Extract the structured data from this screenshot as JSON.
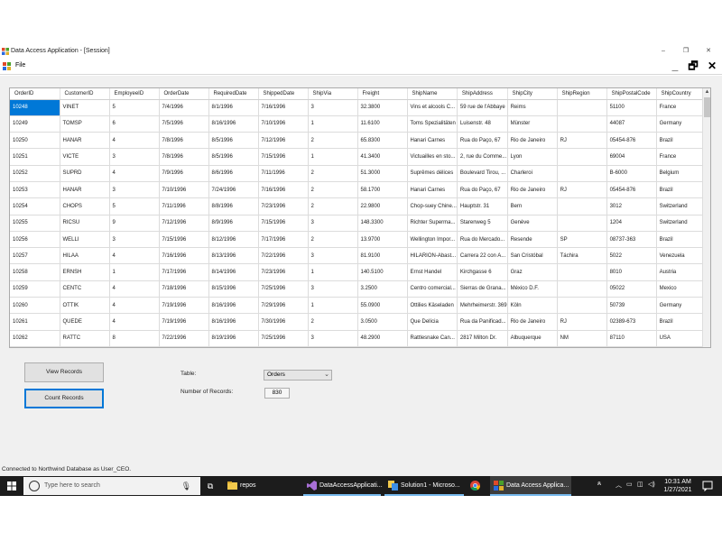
{
  "window": {
    "title": "Data Access Application - [Session]",
    "minimize": "–",
    "restore": "❐",
    "close": "✕"
  },
  "menu": {
    "file": "File",
    "mdi_minimize": "_",
    "mdi_restore": "🗗",
    "mdi_close": "✕"
  },
  "grid": {
    "columns": [
      "OrderID",
      "CustomerID",
      "EmployeeID",
      "OrderDate",
      "RequiredDate",
      "ShippedDate",
      "ShipVia",
      "Freight",
      "ShipName",
      "ShipAddress",
      "ShipCity",
      "ShipRegion",
      "ShipPostalCode",
      "ShipCountry"
    ],
    "rows": [
      [
        "10248",
        "VINET",
        "5",
        "7/4/1996",
        "8/1/1996",
        "7/16/1996",
        "3",
        "32.3800",
        "Vins et alcools C...",
        "59 rue de l'Abbaye",
        "Reims",
        "",
        "51100",
        "France"
      ],
      [
        "10249",
        "TOMSP",
        "6",
        "7/5/1996",
        "8/16/1996",
        "7/10/1996",
        "1",
        "11.6100",
        "Toms Spezialitäten",
        "Luisenstr. 48",
        "Münster",
        "",
        "44087",
        "Germany"
      ],
      [
        "10250",
        "HANAR",
        "4",
        "7/8/1996",
        "8/5/1996",
        "7/12/1996",
        "2",
        "65.8300",
        "Hanari Carnes",
        "Rua do Paço, 67",
        "Rio de Janeiro",
        "RJ",
        "05454-876",
        "Brazil"
      ],
      [
        "10251",
        "VICTE",
        "3",
        "7/8/1996",
        "8/5/1996",
        "7/15/1996",
        "1",
        "41.3400",
        "Victuailles en sto...",
        "2, rue du Comme...",
        "Lyon",
        "",
        "69004",
        "France"
      ],
      [
        "10252",
        "SUPRD",
        "4",
        "7/9/1996",
        "8/6/1996",
        "7/11/1996",
        "2",
        "51.3000",
        "Suprêmes délices",
        "Boulevard Tirou, ...",
        "Charleroi",
        "",
        "B-6000",
        "Belgium"
      ],
      [
        "10253",
        "HANAR",
        "3",
        "7/10/1996",
        "7/24/1996",
        "7/16/1996",
        "2",
        "58.1700",
        "Hanari Carnes",
        "Rua do Paço, 67",
        "Rio de Janeiro",
        "RJ",
        "05454-876",
        "Brazil"
      ],
      [
        "10254",
        "CHOPS",
        "5",
        "7/11/1996",
        "8/8/1996",
        "7/23/1996",
        "2",
        "22.9800",
        "Chop-suey Chine...",
        "Hauptstr. 31",
        "Bern",
        "",
        "3012",
        "Switzerland"
      ],
      [
        "10255",
        "RICSU",
        "9",
        "7/12/1996",
        "8/9/1996",
        "7/15/1996",
        "3",
        "148.3300",
        "Richter Superma...",
        "Starenweg 5",
        "Genève",
        "",
        "1204",
        "Switzerland"
      ],
      [
        "10256",
        "WELLI",
        "3",
        "7/15/1996",
        "8/12/1996",
        "7/17/1996",
        "2",
        "13.9700",
        "Wellington Impor...",
        "Rua do Mercado...",
        "Resende",
        "SP",
        "08737-363",
        "Brazil"
      ],
      [
        "10257",
        "HILAA",
        "4",
        "7/16/1996",
        "8/13/1996",
        "7/22/1996",
        "3",
        "81.9100",
        "HILARION-Abast...",
        "Carrera 22 con A...",
        "San Cristóbal",
        "Táchira",
        "5022",
        "Venezuela"
      ],
      [
        "10258",
        "ERNSH",
        "1",
        "7/17/1996",
        "8/14/1996",
        "7/23/1996",
        "1",
        "140.5100",
        "Ernst Handel",
        "Kirchgasse 6",
        "Graz",
        "",
        "8010",
        "Austria"
      ],
      [
        "10259",
        "CENTC",
        "4",
        "7/18/1996",
        "8/15/1996",
        "7/25/1996",
        "3",
        "3.2500",
        "Centro comercial...",
        "Sierras de Grana...",
        "México D.F.",
        "",
        "05022",
        "Mexico"
      ],
      [
        "10260",
        "OTTIK",
        "4",
        "7/19/1996",
        "8/16/1996",
        "7/29/1996",
        "1",
        "55.0900",
        "Ottilies Käseladen",
        "Mehrheimerstr. 369",
        "Köln",
        "",
        "50739",
        "Germany"
      ],
      [
        "10261",
        "QUEDE",
        "4",
        "7/19/1996",
        "8/16/1996",
        "7/30/1996",
        "2",
        "3.0500",
        "Que Delícia",
        "Rua da Panificad...",
        "Rio de Janeiro",
        "RJ",
        "02389-673",
        "Brazil"
      ],
      [
        "10262",
        "RATTC",
        "8",
        "7/22/1996",
        "8/19/1996",
        "7/25/1996",
        "3",
        "48.2900",
        "Rattlesnake Can...",
        "2817 Milton Dr.",
        "Albuquerque",
        "NM",
        "87110",
        "USA"
      ]
    ]
  },
  "controls": {
    "view_records": "View Records",
    "count_records": "Count Records",
    "table_label": "Table:",
    "table_value": "Orders",
    "records_label": "Number of Records:",
    "records_value": "830"
  },
  "status": {
    "text": "Connected to Northwind Database as User_CEO."
  },
  "taskbar": {
    "search_placeholder": "Type here to search",
    "apps": [
      {
        "label": "repos",
        "icon": "folder-icon"
      },
      {
        "label": "DataAccessApplicati...",
        "icon": "visual-studio-icon"
      },
      {
        "label": "Solution1 - Microso...",
        "icon": "solution-icon"
      },
      {
        "label": "",
        "icon": "chrome-icon"
      },
      {
        "label": "Data Access Applica...",
        "icon": "app-icon"
      }
    ],
    "time": "10:31 AM",
    "date": "1/27/2021"
  },
  "colors": {
    "selection": "#0078d7",
    "taskbar": "#1c1c1c",
    "form_bg": "#f0f0f0"
  }
}
